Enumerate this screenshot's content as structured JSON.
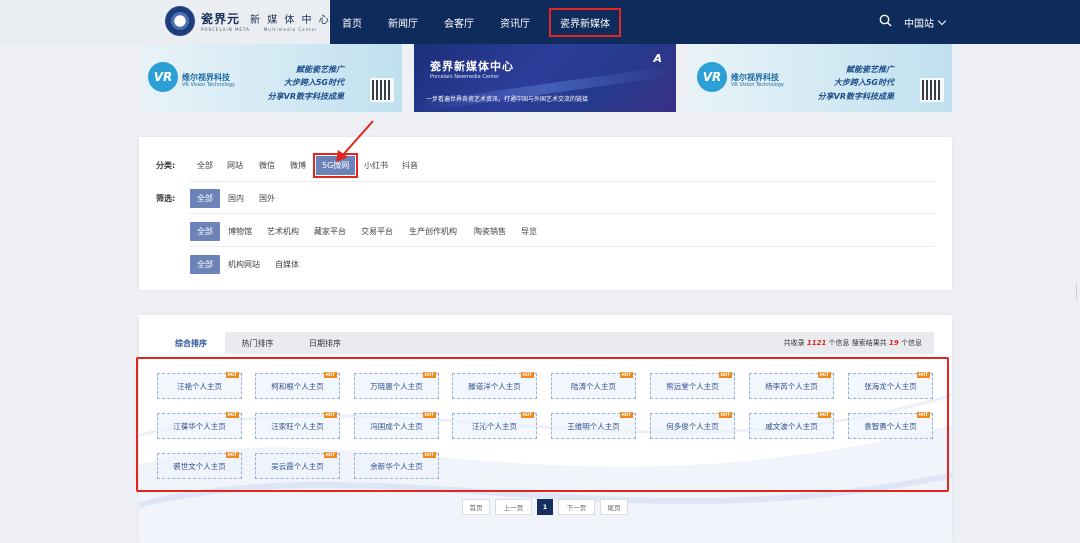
{
  "header": {
    "logo_cn": "瓷界元",
    "logo_cn2": "新 媒 体 中 心",
    "logo_sub": "PORCELAIN META",
    "logo_sub2": "Multimedia Center",
    "nav": [
      "首页",
      "新闻厅",
      "会客厅",
      "资讯厅",
      "瓷界新媒体"
    ],
    "region": "中国站"
  },
  "banners": {
    "vr": {
      "name": "维尔视界科技",
      "name_en": "VR Vision Technology",
      "line1": "赋能瓷艺推广",
      "line2": "大步跨入5G时代",
      "line3": "分享VR数字科技成果"
    },
    "center": {
      "title": "瓷界新媒体中心",
      "title_en": "Porcelain Newmedia Center",
      "slogan": "一步看遍世界各瓷艺术资讯，打通中国与外国艺术交流的链接",
      "mark": "A"
    }
  },
  "filters": {
    "category_label": "分类:",
    "categories": [
      "全部",
      "网站",
      "微信",
      "微博",
      "5G微网",
      "小红书",
      "抖音"
    ],
    "screen_label": "筛选:",
    "region_options": [
      "全部",
      "国内",
      "国外"
    ],
    "type_options": [
      "全部",
      "博物馆",
      "艺术机构",
      "藏家平台",
      "交易平台",
      "生产创作机构",
      "陶瓷销售",
      "导览"
    ],
    "site_options": [
      "全部",
      "机构网站",
      "自媒体"
    ]
  },
  "results": {
    "tabs": [
      "综合排序",
      "热门排序",
      "日期排序"
    ],
    "count_prefix": "共收录",
    "count_total": "1121",
    "count_mid": "个信息  搜索结果共",
    "count_results": "19",
    "count_suffix": "个信息",
    "hot_label": "HOT",
    "cards": [
      "汪艳个人主页",
      "柯和根个人主页",
      "万晓惠个人主页",
      "滕道洋个人主页",
      "陆涛个人主页",
      "熊远堂个人主页",
      "杨李芮个人主页",
      "张海龙个人主页",
      "江葆华个人主页",
      "汪家旺个人主页",
      "冯国成个人主页",
      "汪沁个人主页",
      "王维明个人主页",
      "何多俊个人主页",
      "戚文波个人主页",
      "袁智勇个人主页",
      "裘世文个人主页",
      "吴云霞个人主页",
      "余新华个人主页"
    ]
  },
  "pagination": [
    "首页",
    "上一页",
    "1",
    "下一页",
    "尾页"
  ],
  "colors": {
    "nav_bg": "#0f2b5c",
    "accent": "#6b83b6",
    "highlight": "#e0261f"
  }
}
